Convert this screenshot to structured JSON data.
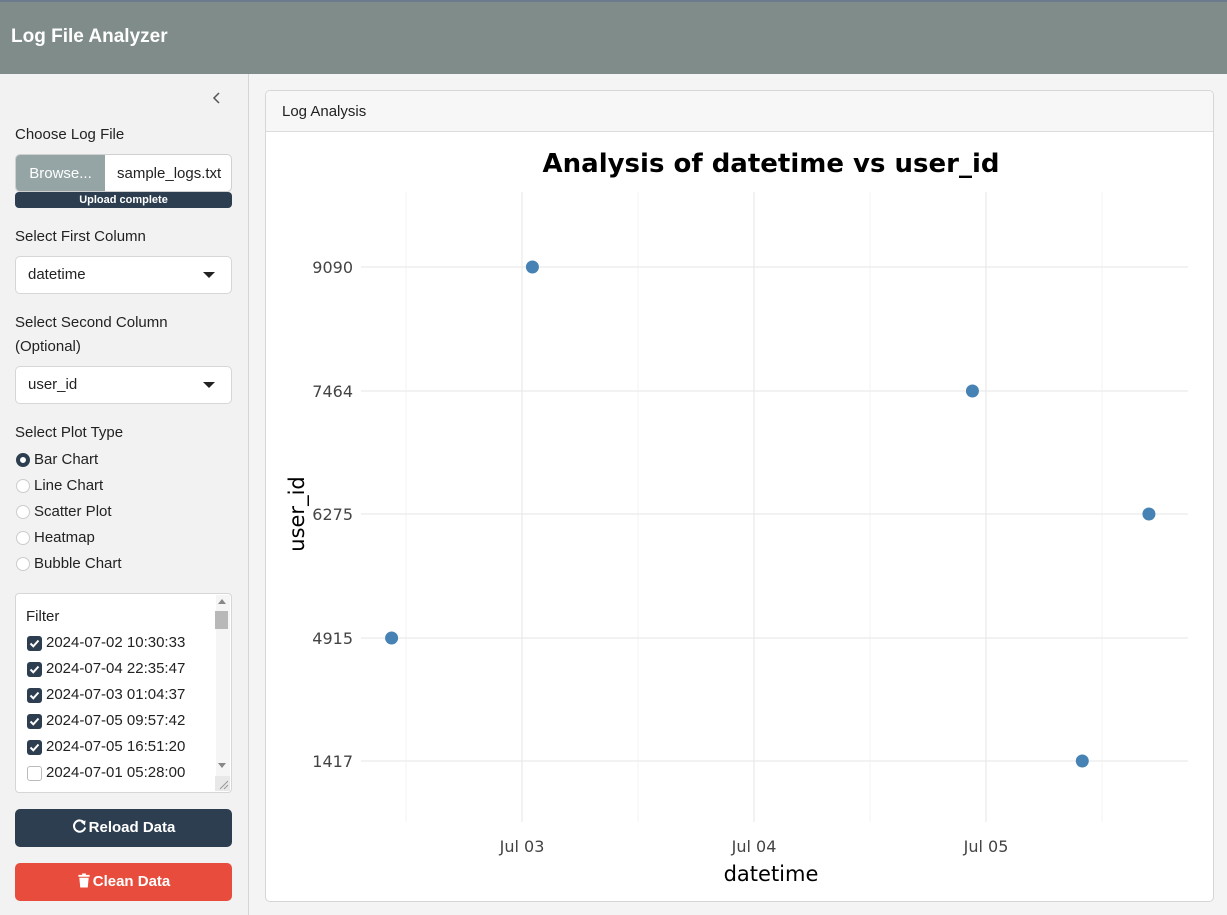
{
  "app": {
    "title": "Log File Analyzer"
  },
  "sidebar": {
    "collapse_icon": "chevron-left-icon",
    "file_label": "Choose Log File",
    "browse_label": "Browse...",
    "file_name": "sample_logs.txt",
    "upload_status": "Upload complete",
    "first_column_label": "Select First Column",
    "first_column_value": "datetime",
    "second_column_label_line1": "Select Second Column",
    "second_column_label_line2": "(Optional)",
    "second_column_value": "user_id",
    "plot_type_label": "Select Plot Type",
    "plot_types": [
      {
        "label": "Bar Chart",
        "selected": true
      },
      {
        "label": "Line Chart",
        "selected": false
      },
      {
        "label": "Scatter Plot",
        "selected": false
      },
      {
        "label": "Heatmap",
        "selected": false
      },
      {
        "label": "Bubble Chart",
        "selected": false
      }
    ],
    "filter": {
      "title": "Filter",
      "items": [
        {
          "label": "2024-07-02 10:30:33",
          "checked": true
        },
        {
          "label": "2024-07-04 22:35:47",
          "checked": true
        },
        {
          "label": "2024-07-03 01:04:37",
          "checked": true
        },
        {
          "label": "2024-07-05 09:57:42",
          "checked": true
        },
        {
          "label": "2024-07-05 16:51:20",
          "checked": true
        },
        {
          "label": "2024-07-01 05:28:00",
          "checked": false
        }
      ]
    },
    "reload_label": "Reload Data",
    "reload_icon": "refresh-icon",
    "clean_label": "Clean Data",
    "clean_icon": "trash-icon"
  },
  "main": {
    "card_title": "Log Analysis"
  },
  "colors": {
    "navbar": "#7f8c8a",
    "primary": "#2c3e50",
    "danger": "#e74c3c",
    "point": "#4682b4"
  },
  "chart_data": {
    "type": "scatter",
    "title": "Analysis of datetime vs user_id",
    "xlabel": "datetime",
    "ylabel": "user_id",
    "x_ticks": [
      "Jul 03",
      "Jul 04",
      "Jul 05"
    ],
    "y_ticks": [
      "1417",
      "4915",
      "6275",
      "7464",
      "9090"
    ],
    "y_scale": "categorical",
    "grid": true,
    "points": [
      {
        "x": "2024-07-02 10:30:33",
        "y": "4915"
      },
      {
        "x": "2024-07-03 01:04:37",
        "y": "9090"
      },
      {
        "x": "2024-07-04 22:35:47",
        "y": "7464"
      },
      {
        "x": "2024-07-05 09:57:42",
        "y": "1417"
      },
      {
        "x": "2024-07-05 16:51:20",
        "y": "6275"
      }
    ]
  }
}
